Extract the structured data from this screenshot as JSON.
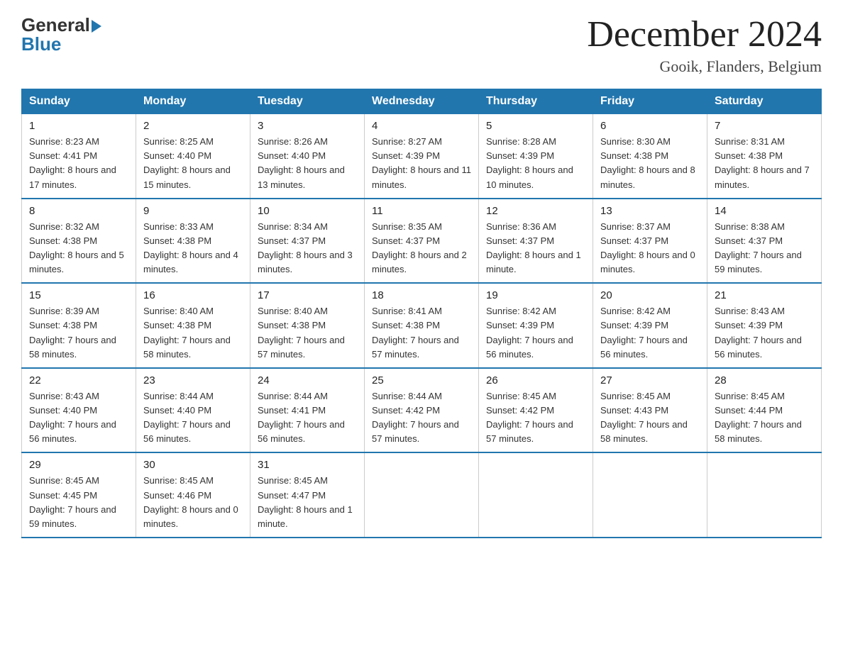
{
  "header": {
    "logo_general": "General",
    "logo_blue": "Blue",
    "month_title": "December 2024",
    "location": "Gooik, Flanders, Belgium"
  },
  "days_of_week": [
    "Sunday",
    "Monday",
    "Tuesday",
    "Wednesday",
    "Thursday",
    "Friday",
    "Saturday"
  ],
  "weeks": [
    [
      {
        "day": "1",
        "sunrise": "8:23 AM",
        "sunset": "4:41 PM",
        "daylight": "8 hours and 17 minutes."
      },
      {
        "day": "2",
        "sunrise": "8:25 AM",
        "sunset": "4:40 PM",
        "daylight": "8 hours and 15 minutes."
      },
      {
        "day": "3",
        "sunrise": "8:26 AM",
        "sunset": "4:40 PM",
        "daylight": "8 hours and 13 minutes."
      },
      {
        "day": "4",
        "sunrise": "8:27 AM",
        "sunset": "4:39 PM",
        "daylight": "8 hours and 11 minutes."
      },
      {
        "day": "5",
        "sunrise": "8:28 AM",
        "sunset": "4:39 PM",
        "daylight": "8 hours and 10 minutes."
      },
      {
        "day": "6",
        "sunrise": "8:30 AM",
        "sunset": "4:38 PM",
        "daylight": "8 hours and 8 minutes."
      },
      {
        "day": "7",
        "sunrise": "8:31 AM",
        "sunset": "4:38 PM",
        "daylight": "8 hours and 7 minutes."
      }
    ],
    [
      {
        "day": "8",
        "sunrise": "8:32 AM",
        "sunset": "4:38 PM",
        "daylight": "8 hours and 5 minutes."
      },
      {
        "day": "9",
        "sunrise": "8:33 AM",
        "sunset": "4:38 PM",
        "daylight": "8 hours and 4 minutes."
      },
      {
        "day": "10",
        "sunrise": "8:34 AM",
        "sunset": "4:37 PM",
        "daylight": "8 hours and 3 minutes."
      },
      {
        "day": "11",
        "sunrise": "8:35 AM",
        "sunset": "4:37 PM",
        "daylight": "8 hours and 2 minutes."
      },
      {
        "day": "12",
        "sunrise": "8:36 AM",
        "sunset": "4:37 PM",
        "daylight": "8 hours and 1 minute."
      },
      {
        "day": "13",
        "sunrise": "8:37 AM",
        "sunset": "4:37 PM",
        "daylight": "8 hours and 0 minutes."
      },
      {
        "day": "14",
        "sunrise": "8:38 AM",
        "sunset": "4:37 PM",
        "daylight": "7 hours and 59 minutes."
      }
    ],
    [
      {
        "day": "15",
        "sunrise": "8:39 AM",
        "sunset": "4:38 PM",
        "daylight": "7 hours and 58 minutes."
      },
      {
        "day": "16",
        "sunrise": "8:40 AM",
        "sunset": "4:38 PM",
        "daylight": "7 hours and 58 minutes."
      },
      {
        "day": "17",
        "sunrise": "8:40 AM",
        "sunset": "4:38 PM",
        "daylight": "7 hours and 57 minutes."
      },
      {
        "day": "18",
        "sunrise": "8:41 AM",
        "sunset": "4:38 PM",
        "daylight": "7 hours and 57 minutes."
      },
      {
        "day": "19",
        "sunrise": "8:42 AM",
        "sunset": "4:39 PM",
        "daylight": "7 hours and 56 minutes."
      },
      {
        "day": "20",
        "sunrise": "8:42 AM",
        "sunset": "4:39 PM",
        "daylight": "7 hours and 56 minutes."
      },
      {
        "day": "21",
        "sunrise": "8:43 AM",
        "sunset": "4:39 PM",
        "daylight": "7 hours and 56 minutes."
      }
    ],
    [
      {
        "day": "22",
        "sunrise": "8:43 AM",
        "sunset": "4:40 PM",
        "daylight": "7 hours and 56 minutes."
      },
      {
        "day": "23",
        "sunrise": "8:44 AM",
        "sunset": "4:40 PM",
        "daylight": "7 hours and 56 minutes."
      },
      {
        "day": "24",
        "sunrise": "8:44 AM",
        "sunset": "4:41 PM",
        "daylight": "7 hours and 56 minutes."
      },
      {
        "day": "25",
        "sunrise": "8:44 AM",
        "sunset": "4:42 PM",
        "daylight": "7 hours and 57 minutes."
      },
      {
        "day": "26",
        "sunrise": "8:45 AM",
        "sunset": "4:42 PM",
        "daylight": "7 hours and 57 minutes."
      },
      {
        "day": "27",
        "sunrise": "8:45 AM",
        "sunset": "4:43 PM",
        "daylight": "7 hours and 58 minutes."
      },
      {
        "day": "28",
        "sunrise": "8:45 AM",
        "sunset": "4:44 PM",
        "daylight": "7 hours and 58 minutes."
      }
    ],
    [
      {
        "day": "29",
        "sunrise": "8:45 AM",
        "sunset": "4:45 PM",
        "daylight": "7 hours and 59 minutes."
      },
      {
        "day": "30",
        "sunrise": "8:45 AM",
        "sunset": "4:46 PM",
        "daylight": "8 hours and 0 minutes."
      },
      {
        "day": "31",
        "sunrise": "8:45 AM",
        "sunset": "4:47 PM",
        "daylight": "8 hours and 1 minute."
      },
      null,
      null,
      null,
      null
    ]
  ]
}
